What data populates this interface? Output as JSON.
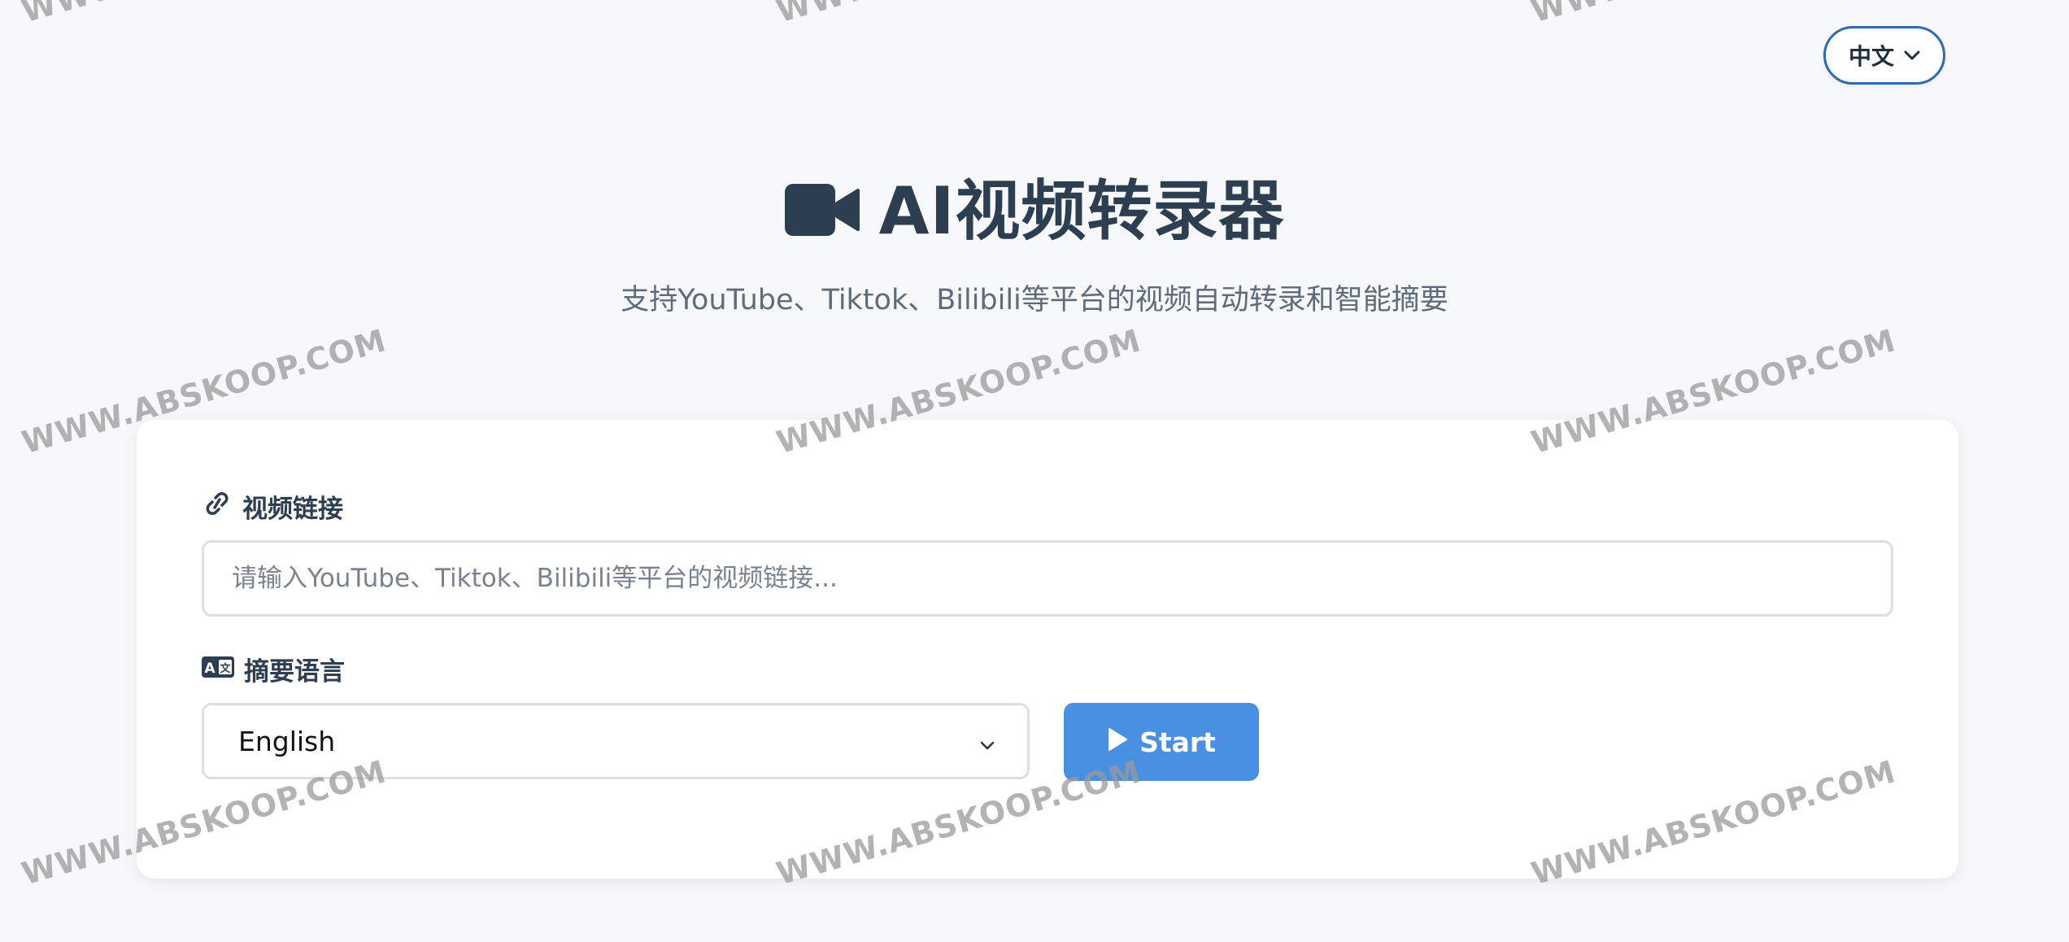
{
  "header": {
    "language_button_label": "中文"
  },
  "hero": {
    "title": "AI视频转录器",
    "subtitle": "支持YouTube、Tiktok、Bilibili等平台的视频自动转录和智能摘要"
  },
  "form": {
    "video_link_label": "视频链接",
    "video_link_placeholder": "请输入YouTube、Tiktok、Bilibili等平台的视频链接...",
    "video_link_value": "",
    "summary_language_label": "摘要语言",
    "summary_language_selected": "English",
    "start_button_label": "Start"
  },
  "watermark": {
    "text": "WWW.ABSKOOP.COM"
  },
  "colors": {
    "accent": "#4a90e2",
    "title": "#2c3e50",
    "language_button_border": "#2b6cb0",
    "background": "#f7f8fa"
  },
  "icons": {
    "language_button": "chevron-down-icon",
    "title": "video-camera-icon",
    "video_link": "link-icon",
    "summary_language": "language-icon",
    "select": "chevron-down-icon",
    "start_button": "play-icon"
  }
}
